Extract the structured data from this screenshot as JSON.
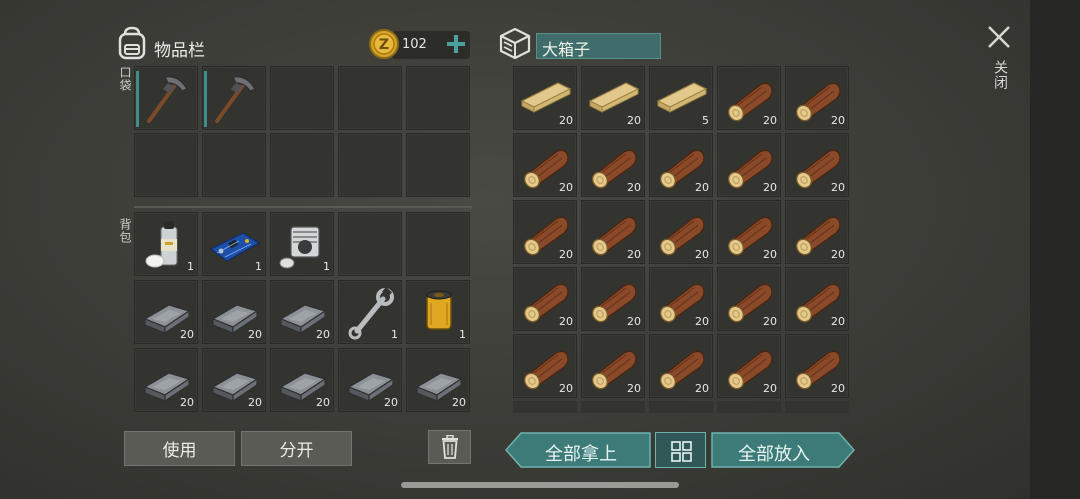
{
  "inventory": {
    "title": "物品栏",
    "coin_count": "102",
    "pocket_label": "口袋",
    "backpack_label": "背包"
  },
  "pocket": [
    {
      "item": "pickaxe",
      "equipped": true,
      "count": ""
    },
    {
      "item": "pickaxe",
      "equipped": true,
      "count": ""
    },
    {
      "item": "",
      "count": ""
    },
    {
      "item": "",
      "count": ""
    },
    {
      "item": "",
      "count": ""
    },
    {
      "item": "",
      "count": ""
    },
    {
      "item": "",
      "count": ""
    },
    {
      "item": "",
      "count": ""
    },
    {
      "item": "",
      "count": ""
    },
    {
      "item": "",
      "count": ""
    }
  ],
  "backpack": [
    {
      "item": "spray-can",
      "count": "1"
    },
    {
      "item": "circuit-board",
      "count": "1"
    },
    {
      "item": "engine-cylinder",
      "count": "1"
    },
    {
      "item": "",
      "count": ""
    },
    {
      "item": "",
      "count": ""
    },
    {
      "item": "iron-ingot",
      "count": "20"
    },
    {
      "item": "iron-ingot",
      "count": "20"
    },
    {
      "item": "iron-ingot",
      "count": "20"
    },
    {
      "item": "wrench",
      "count": "1"
    },
    {
      "item": "oil-filter",
      "count": "1"
    },
    {
      "item": "iron-ingot",
      "count": "20"
    },
    {
      "item": "iron-ingot",
      "count": "20"
    },
    {
      "item": "iron-ingot",
      "count": "20"
    },
    {
      "item": "iron-ingot",
      "count": "20"
    },
    {
      "item": "iron-ingot",
      "count": "20"
    }
  ],
  "chest": {
    "title": "大箱子",
    "items": [
      {
        "item": "plank",
        "count": "20"
      },
      {
        "item": "plank",
        "count": "20"
      },
      {
        "item": "plank",
        "count": "5"
      },
      {
        "item": "log",
        "count": "20"
      },
      {
        "item": "log",
        "count": "20"
      },
      {
        "item": "log",
        "count": "20"
      },
      {
        "item": "log",
        "count": "20"
      },
      {
        "item": "log",
        "count": "20"
      },
      {
        "item": "log",
        "count": "20"
      },
      {
        "item": "log",
        "count": "20"
      },
      {
        "item": "log",
        "count": "20"
      },
      {
        "item": "log",
        "count": "20"
      },
      {
        "item": "log",
        "count": "20"
      },
      {
        "item": "log",
        "count": "20"
      },
      {
        "item": "log",
        "count": "20"
      },
      {
        "item": "log",
        "count": "20"
      },
      {
        "item": "log",
        "count": "20"
      },
      {
        "item": "log",
        "count": "20"
      },
      {
        "item": "log",
        "count": "20"
      },
      {
        "item": "log",
        "count": "20"
      },
      {
        "item": "log",
        "count": "20"
      },
      {
        "item": "log",
        "count": "20"
      },
      {
        "item": "log",
        "count": "20"
      },
      {
        "item": "log",
        "count": "20"
      },
      {
        "item": "log",
        "count": "20"
      }
    ]
  },
  "buttons": {
    "use": "使用",
    "split": "分开",
    "take_all": "全部拿上",
    "put_all": "全部放入",
    "close": "关闭"
  },
  "colors": {
    "teal": "#3f8c8a",
    "teal_button": "#3d7b79",
    "gold": "#d9a426"
  }
}
